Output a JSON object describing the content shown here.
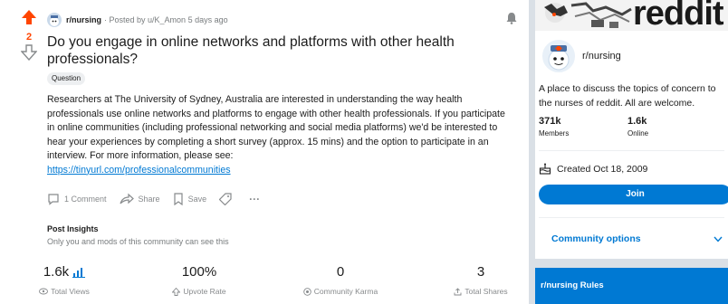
{
  "post": {
    "vote_count": "2",
    "subreddit": "r/nursing",
    "posted_by": "· Posted by u/K_Amon 5 days ago",
    "title": "Do you engage in online networks and platforms with other health professionals?",
    "flair": "Question",
    "body_text": "Researchers at The University of Sydney, Australia are interested in understanding the way health professionals use online networks and platforms to engage with other health professionals. If you participate in online communities (including professional networking and social media platforms) we'd be interested to hear your experiences by completing a short survey (approx. 15 mins) and the option to participate in an interview. For more information, please see:",
    "link": "https://tinyurl.com/professionalcommunities",
    "actions": {
      "comment": "1 Comment",
      "share": "Share",
      "save": "Save",
      "more": "···"
    },
    "insights": {
      "title": "Post Insights",
      "subtitle": "Only you and mods of this community can see this",
      "stats": [
        {
          "value": "1.6k",
          "label": "Total Views"
        },
        {
          "value": "100%",
          "label": "Upvote Rate"
        },
        {
          "value": "0",
          "label": "Community Karma"
        },
        {
          "value": "3",
          "label": "Total Shares"
        }
      ]
    }
  },
  "sidebar": {
    "banner_text": "reddit",
    "name": "r/nursing",
    "description": "A place to discuss the topics of concern to the nurses of reddit. All are welcome.",
    "members_count": "371k",
    "members_label": "Members",
    "online_count": "1.6k",
    "online_label": "Online",
    "created": "Created Oct 18, 2009",
    "join_label": "Join",
    "community_options": "Community options",
    "rules_title": "r/nursing Rules"
  },
  "colors": {
    "upvote": "#ff4500",
    "link": "#0079d3",
    "join": "#0079d3"
  },
  "icons": [
    "upvote-arrow-icon",
    "downvote-arrow-icon",
    "bell-icon",
    "comment-icon",
    "share-icon",
    "save-icon",
    "tag-icon",
    "bar-chart-icon",
    "eye-icon",
    "upvote-rate-icon",
    "karma-icon",
    "share-total-icon",
    "cake-icon",
    "chevron-down-icon"
  ]
}
